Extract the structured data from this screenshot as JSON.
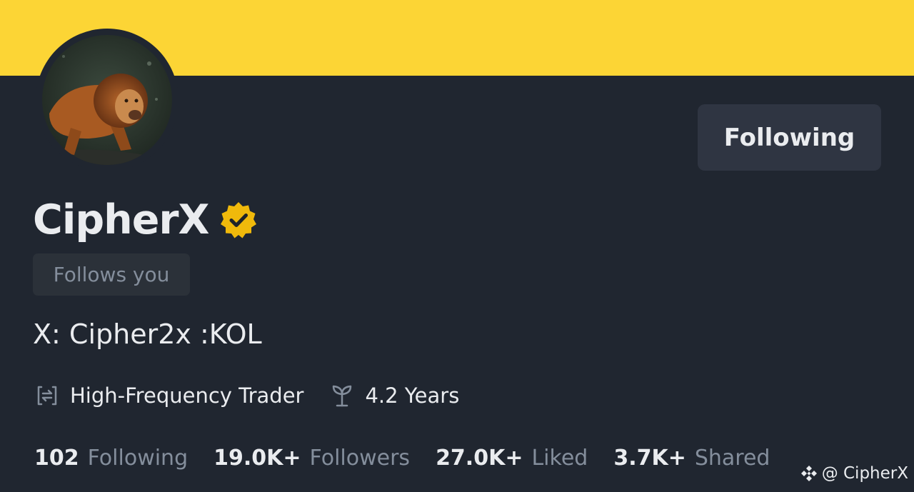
{
  "profile": {
    "name": "CipherX",
    "follow_button_label": "Following",
    "follows_you_badge": "Follows you",
    "bio": "X: Cipher2x :KOL",
    "avatar_description_icon": "lion-avatar",
    "verified_icon": "verified-badge-icon"
  },
  "tags": [
    {
      "icon": "trade-swap-icon",
      "label": "High-Frequency Trader"
    },
    {
      "icon": "sprout-icon",
      "label": "4.2 Years"
    }
  ],
  "stats": [
    {
      "value": "102",
      "label": "Following"
    },
    {
      "value": "19.0K+",
      "label": "Followers"
    },
    {
      "value": "27.0K+",
      "label": "Liked"
    },
    {
      "value": "3.7K+",
      "label": "Shared"
    }
  ],
  "watermark": {
    "icon": "binance-logo-icon",
    "text": "@ CipherX"
  },
  "colors": {
    "banner": "#FCD535",
    "background": "#202630",
    "button_bg": "#2F3542",
    "badge_bg": "#2B3139",
    "primary_text": "#EAECEF",
    "secondary_text": "#848E9C",
    "verified_gold": "#F0B90B"
  }
}
